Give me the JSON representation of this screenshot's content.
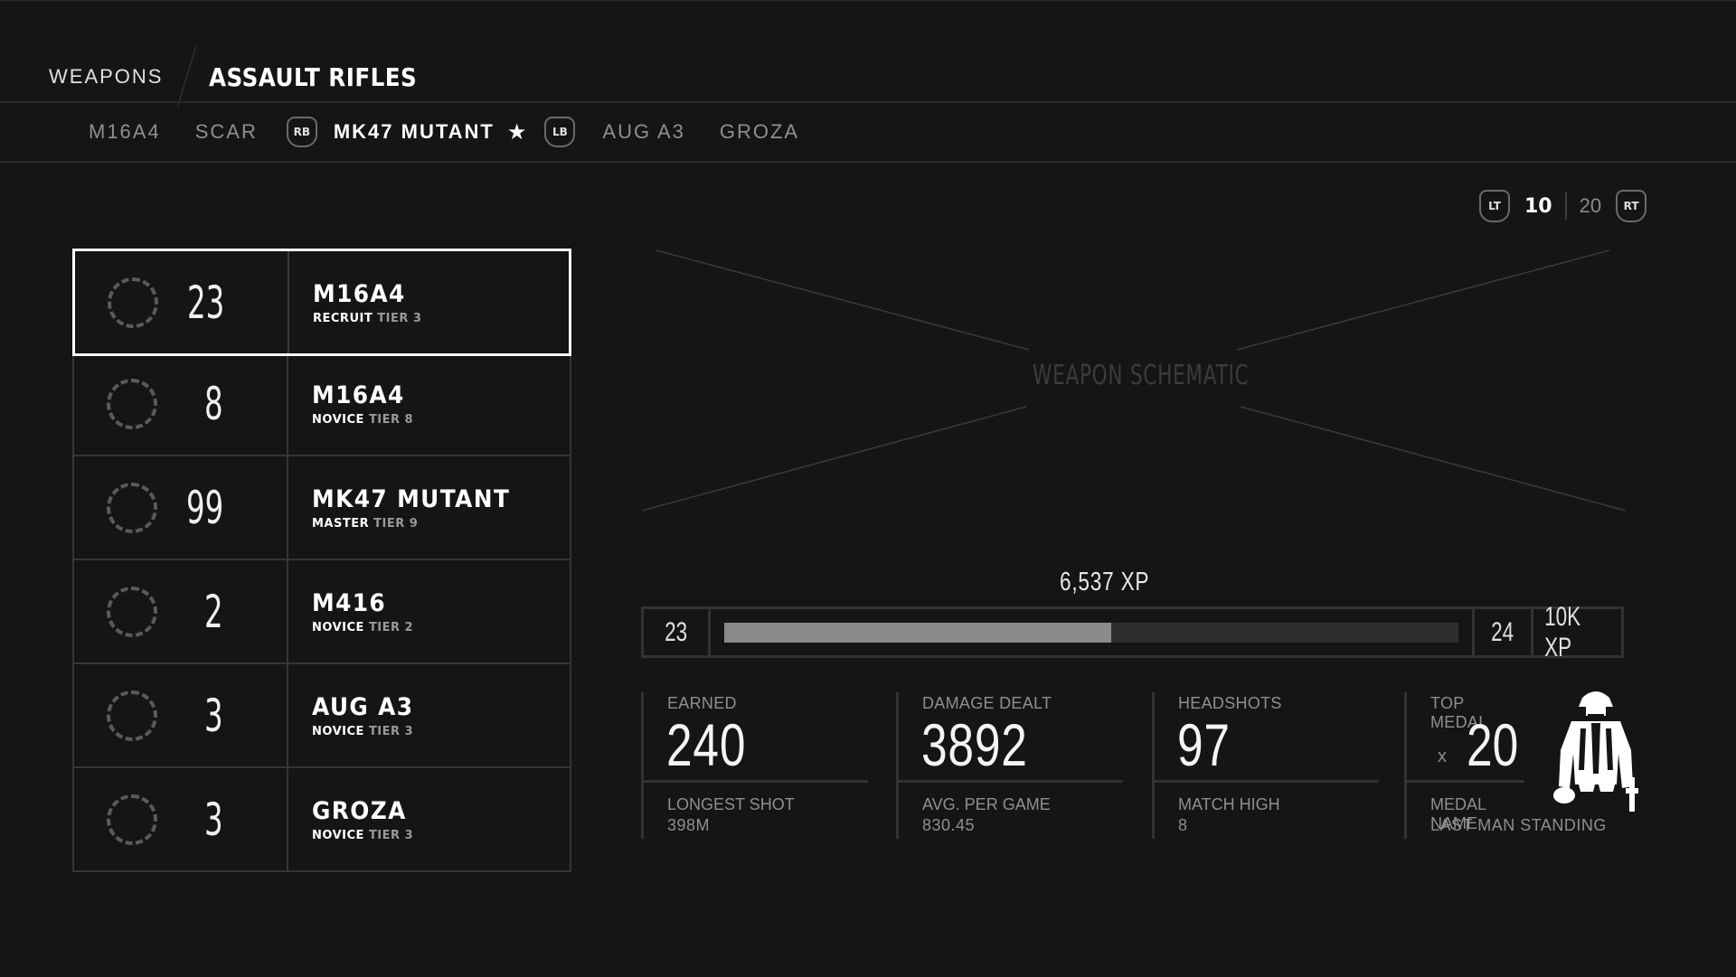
{
  "header": {
    "parent": "WEAPONS",
    "current": "ASSAULT RIFLES"
  },
  "tabs": {
    "items": [
      "M16A4",
      "SCAR",
      "MK47 MUTANT",
      "AUG A3",
      "GROZA"
    ],
    "active_index": 2,
    "prev_hint": "RB",
    "next_hint": "LB",
    "favorite_icon": "star-icon"
  },
  "pager": {
    "prev_hint": "LT",
    "current": "10",
    "other": "20",
    "next_hint": "RT"
  },
  "weapons": [
    {
      "level": "23",
      "name": "M16A4",
      "rank": "RECRUIT",
      "tier": "TIER 3",
      "selected": true
    },
    {
      "level": "8",
      "name": "M16A4",
      "rank": "NOVICE",
      "tier": "TIER 8",
      "selected": false
    },
    {
      "level": "99",
      "name": "MK47 MUTANT",
      "rank": "MASTER",
      "tier": "TIER 9",
      "selected": false
    },
    {
      "level": "2",
      "name": "M416",
      "rank": "NOVICE",
      "tier": "TIER 2",
      "selected": false
    },
    {
      "level": "3",
      "name": "AUG A3",
      "rank": "NOVICE",
      "tier": "TIER 3",
      "selected": false
    },
    {
      "level": "3",
      "name": "GROZA",
      "rank": "NOVICE",
      "tier": "TIER 3",
      "selected": false
    }
  ],
  "schematic": {
    "label": "WEAPON SCHEMATIC"
  },
  "xp": {
    "total": "6,537 XP",
    "current_level": "23",
    "next_level": "24",
    "goal": "10K XP",
    "progress": 0.527
  },
  "stats": {
    "earned": {
      "label": "EARNED",
      "value": "240",
      "sub_label": "LONGEST SHOT",
      "sub_value": "398M"
    },
    "damage": {
      "label": "DAMAGE DEALT",
      "value": "3892",
      "sub_label": "AVG. PER GAME",
      "sub_value": "830.45"
    },
    "headshots": {
      "label": "HEADSHOTS",
      "value": "97",
      "sub_label": "MATCH HIGH",
      "sub_value": "8"
    },
    "medal": {
      "label": "TOP MEDAL",
      "multiplier": "x",
      "value": "20",
      "sub_label": "MEDAL NAME",
      "sub_value": "LAST MAN STANDING",
      "icon": "soldier-medal-icon"
    }
  },
  "colors": {
    "background": "#151515",
    "border": "#353535",
    "selected_border": "#ffffff",
    "xp_fill": "#8a8a8a"
  }
}
